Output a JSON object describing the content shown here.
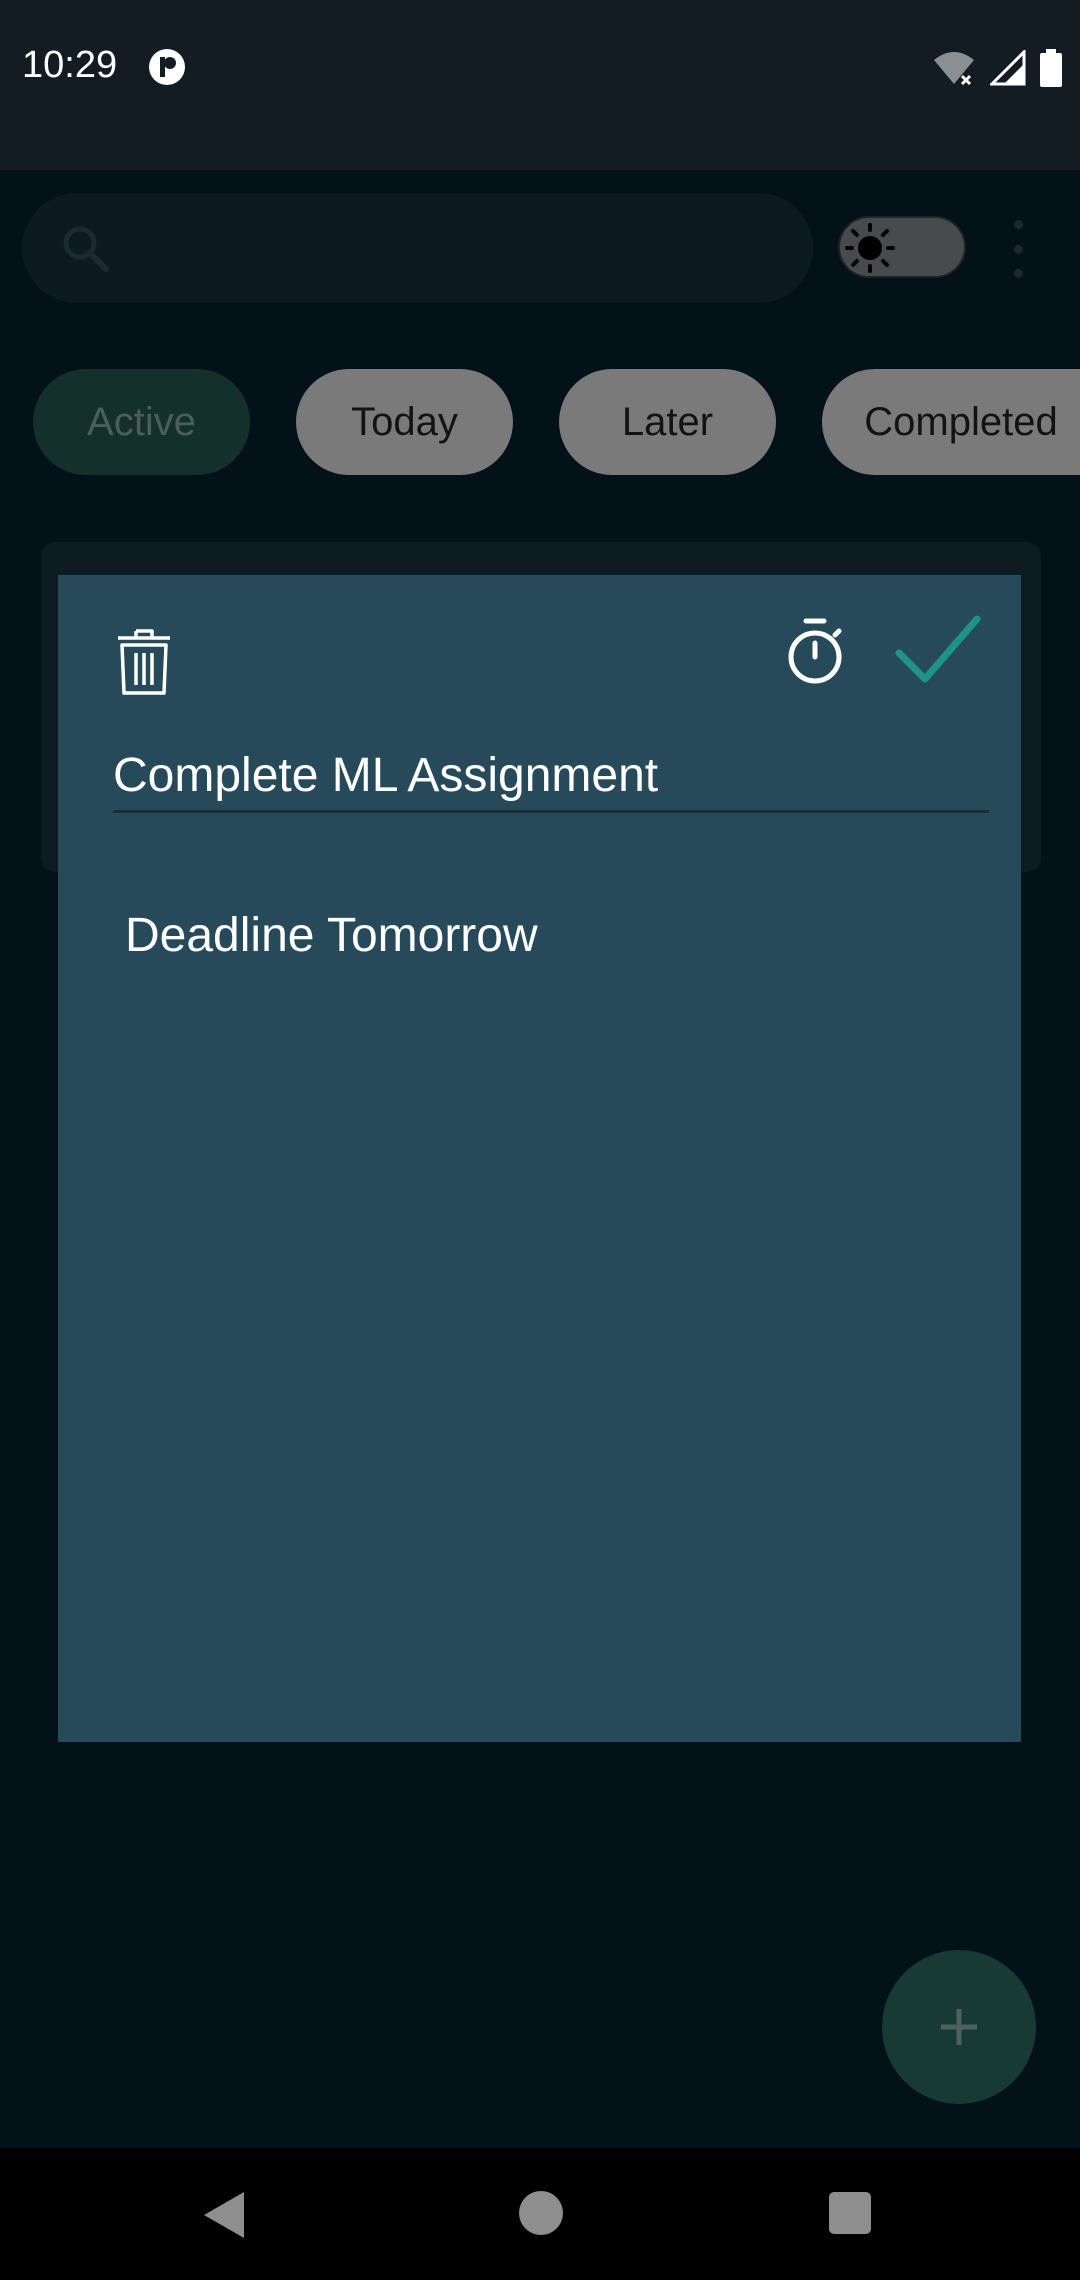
{
  "status_bar": {
    "time": "10:29"
  },
  "search": {
    "placeholder": ""
  },
  "filters": [
    {
      "label": "Active",
      "selected": true
    },
    {
      "label": "Today",
      "selected": false
    },
    {
      "label": "Later",
      "selected": false
    },
    {
      "label": "Completed",
      "selected": false
    }
  ],
  "dialog": {
    "title": "Complete ML Assignment",
    "body": "Deadline Tomorrow"
  },
  "colors": {
    "dialog_bg": "#274a5a",
    "check_accent": "#1e9488",
    "chip_active_bg": "#13302a",
    "fab_bg": "#173a34"
  },
  "icons": {
    "search": "search-icon",
    "theme": "sun-icon",
    "more": "more-vert-icon",
    "delete": "trash-icon",
    "timer": "timer-icon",
    "save": "check-icon",
    "add": "plus-icon"
  }
}
